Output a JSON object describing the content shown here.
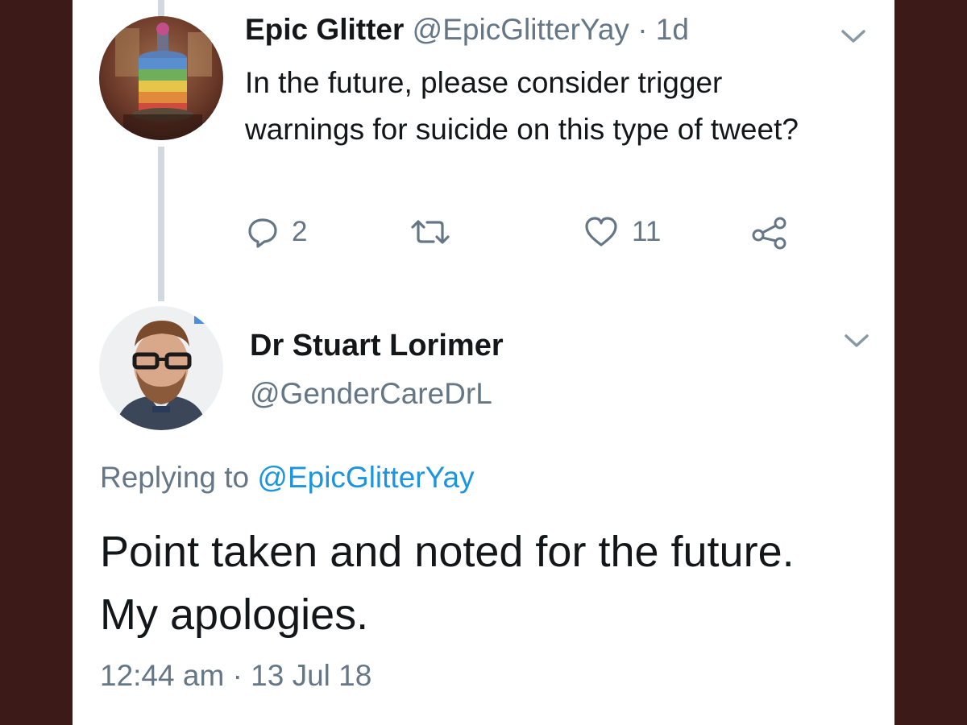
{
  "parent_tweet": {
    "display_name": "Epic Glitter",
    "handle": "@EpicGlitterYay",
    "separator": "·",
    "time_ago": "1d",
    "text": "In the future, please consider trigger warnings for suicide on this type of tweet?",
    "reply_count": "2",
    "like_count": "11",
    "avatar_icon": "cake-photo-avatar",
    "chevron_icon": "chevron-down-icon"
  },
  "reply_tweet": {
    "display_name": "Dr Stuart Lorimer",
    "handle": "@GenderCareDrL",
    "replying_prefix": "Replying to",
    "replying_to": "@EpicGlitterYay",
    "text": "Point taken and noted for the future. My apologies.",
    "time": "12:44 am",
    "separator": "·",
    "date": "13 Jul 18",
    "avatar_icon": "man-with-glasses-avatar",
    "chevron_icon": "chevron-down-icon"
  },
  "colors": {
    "background": "#3c1a17",
    "card": "#ffffff",
    "text": "#14171a",
    "muted": "#657786",
    "link": "#1b95e0",
    "thread_line": "#cfd9de"
  }
}
